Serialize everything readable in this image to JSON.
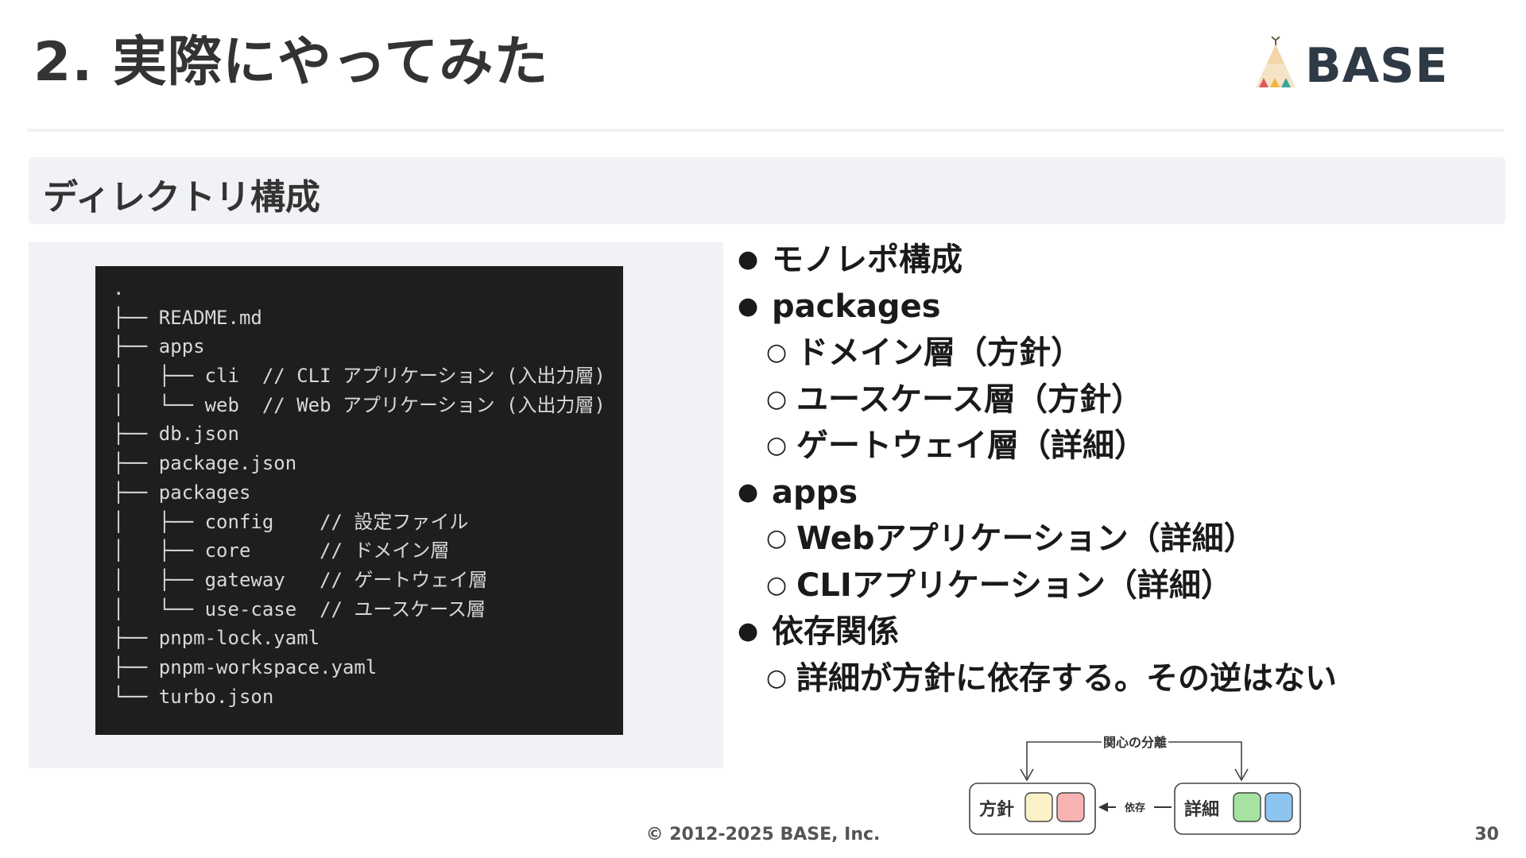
{
  "slide": {
    "title": "2. 実際にやってみた",
    "logo_text": "BASE",
    "section_label": "ディレクトリ構成",
    "copyright": "© 2012-2025 BASE, Inc.",
    "page_number": "30"
  },
  "tree": {
    "lines": [
      ".",
      "├── README.md",
      "├── apps",
      "│   ├── cli  // CLI アプリケーション (入出力層)",
      "│   └── web  // Web アプリケーション (入出力層)",
      "├── db.json",
      "├── package.json",
      "├── packages",
      "│   ├── config    // 設定ファイル",
      "│   ├── core      // ドメイン層",
      "│   ├── gateway   // ゲートウェイ層",
      "│   └── use-case  // ユースケース層",
      "├── pnpm-lock.yaml",
      "├── pnpm-workspace.yaml",
      "└── turbo.json"
    ]
  },
  "bullets": [
    {
      "level": 1,
      "marker": "●",
      "text": "モノレポ構成"
    },
    {
      "level": 1,
      "marker": "●",
      "text": "packages"
    },
    {
      "level": 2,
      "marker": "○",
      "text": "ドメイン層（方針）"
    },
    {
      "level": 2,
      "marker": "○",
      "text": "ユースケース層（方針）"
    },
    {
      "level": 2,
      "marker": "○",
      "text": "ゲートウェイ層（詳細）"
    },
    {
      "level": 1,
      "marker": "●",
      "text": "apps"
    },
    {
      "level": 2,
      "marker": "○",
      "text": "Webアプリケーション（詳細）"
    },
    {
      "level": 2,
      "marker": "○",
      "text": "CLIアプリケーション（詳細）"
    },
    {
      "level": 1,
      "marker": "●",
      "text": "依存関係"
    },
    {
      "level": 2,
      "marker": "○",
      "text": "詳細が方針に依存する。その逆はない"
    }
  ],
  "diagram": {
    "top_label": "関心の分離",
    "left_box_label": "方針",
    "right_box_label": "詳細",
    "arrow_label": "依存",
    "colors": {
      "policy_a": "#fbf1c7",
      "policy_b": "#f7b3b3",
      "detail_a": "#a6e3a1",
      "detail_b": "#8cc4f0"
    }
  },
  "colors": {
    "panel_bg": "#f0f2f5",
    "terminal_bg": "#1e1e1e",
    "logo_text": "#2e3a45"
  }
}
